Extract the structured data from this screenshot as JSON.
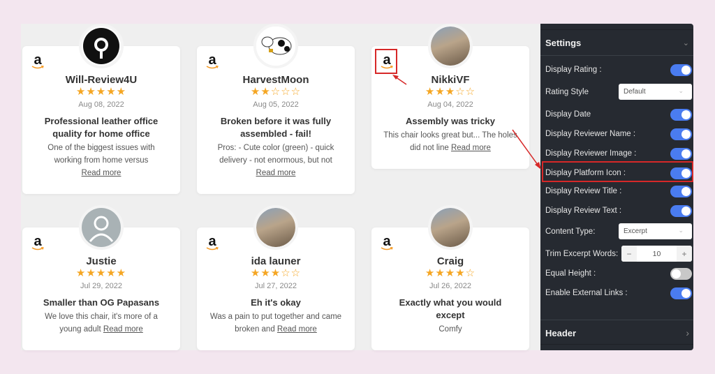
{
  "colors": {
    "accent": "#4a7cf0",
    "star": "#f5a623",
    "panel_bg": "#262a31",
    "page_bg": "#f3e6ef",
    "annotation": "#d62828"
  },
  "reviews": [
    {
      "name": "Will-Review4U",
      "rating": 5,
      "date": "Aug 08, 2022",
      "title": "Professional leather office quality for home office",
      "text": "One of the biggest issues with working from home versus",
      "read_more": "Read more",
      "platform_icon": "amazon-icon",
      "avatar": "logo-avatar"
    },
    {
      "name": "HarvestMoon",
      "rating": 2,
      "date": "Aug 05, 2022",
      "title": "Broken before it was fully assembled - fail!",
      "text": "Pros: - Cute color (green) - quick delivery - not enormous, but not",
      "read_more": "Read more",
      "platform_icon": "amazon-icon",
      "avatar": "cow-avatar"
    },
    {
      "name": "NikkiVF",
      "rating": 3,
      "date": "Aug 04, 2022",
      "title": "Assembly was tricky",
      "text": "This chair looks great but... The holes did not line",
      "read_more": "Read more",
      "platform_icon": "amazon-icon",
      "avatar": "photo-avatar"
    },
    {
      "name": "Justie",
      "rating": 5,
      "date": "Jul 29, 2022",
      "title": "Smaller than OG Papasans",
      "text": "We love this chair, it's more of a young adult",
      "read_more": "Read more",
      "platform_icon": "amazon-icon",
      "avatar": "default-user-avatar"
    },
    {
      "name": "ida launer",
      "rating": 3,
      "date": "Jul 27, 2022",
      "title": "Eh it's okay",
      "text": "Was a pain to put together and came broken and",
      "read_more": "Read more",
      "platform_icon": "amazon-icon",
      "avatar": "photo-avatar"
    },
    {
      "name": "Craig",
      "rating": 4,
      "date": "Jul 26, 2022",
      "title": "Exactly what you would except",
      "text": "Comfy",
      "read_more": "",
      "platform_icon": "amazon-icon",
      "avatar": "photo-avatar"
    }
  ],
  "settings": {
    "title": "Settings",
    "rows": [
      {
        "label": "Display Rating :",
        "type": "toggle",
        "on": true
      },
      {
        "label": "Rating Style",
        "type": "select",
        "value": "Default"
      },
      {
        "label": "Display Date",
        "type": "toggle",
        "on": true
      },
      {
        "label": "Display Reviewer Name :",
        "type": "toggle",
        "on": true
      },
      {
        "label": "Display Reviewer Image :",
        "type": "toggle",
        "on": true
      },
      {
        "label": "Display Platform Icon :",
        "type": "toggle",
        "on": true
      },
      {
        "label": "Display Review Title :",
        "type": "toggle",
        "on": true
      },
      {
        "label": "Display Review Text :",
        "type": "toggle",
        "on": true
      },
      {
        "label": "Content Type:",
        "type": "select",
        "value": "Excerpt"
      },
      {
        "label": "Trim Excerpt Words:",
        "type": "stepper",
        "value": "10",
        "minus": "−",
        "plus": "+"
      },
      {
        "label": "Equal Height :",
        "type": "toggle",
        "on": false
      },
      {
        "label": "Enable External Links :",
        "type": "toggle",
        "on": true
      }
    ],
    "footer_section": "Header"
  }
}
